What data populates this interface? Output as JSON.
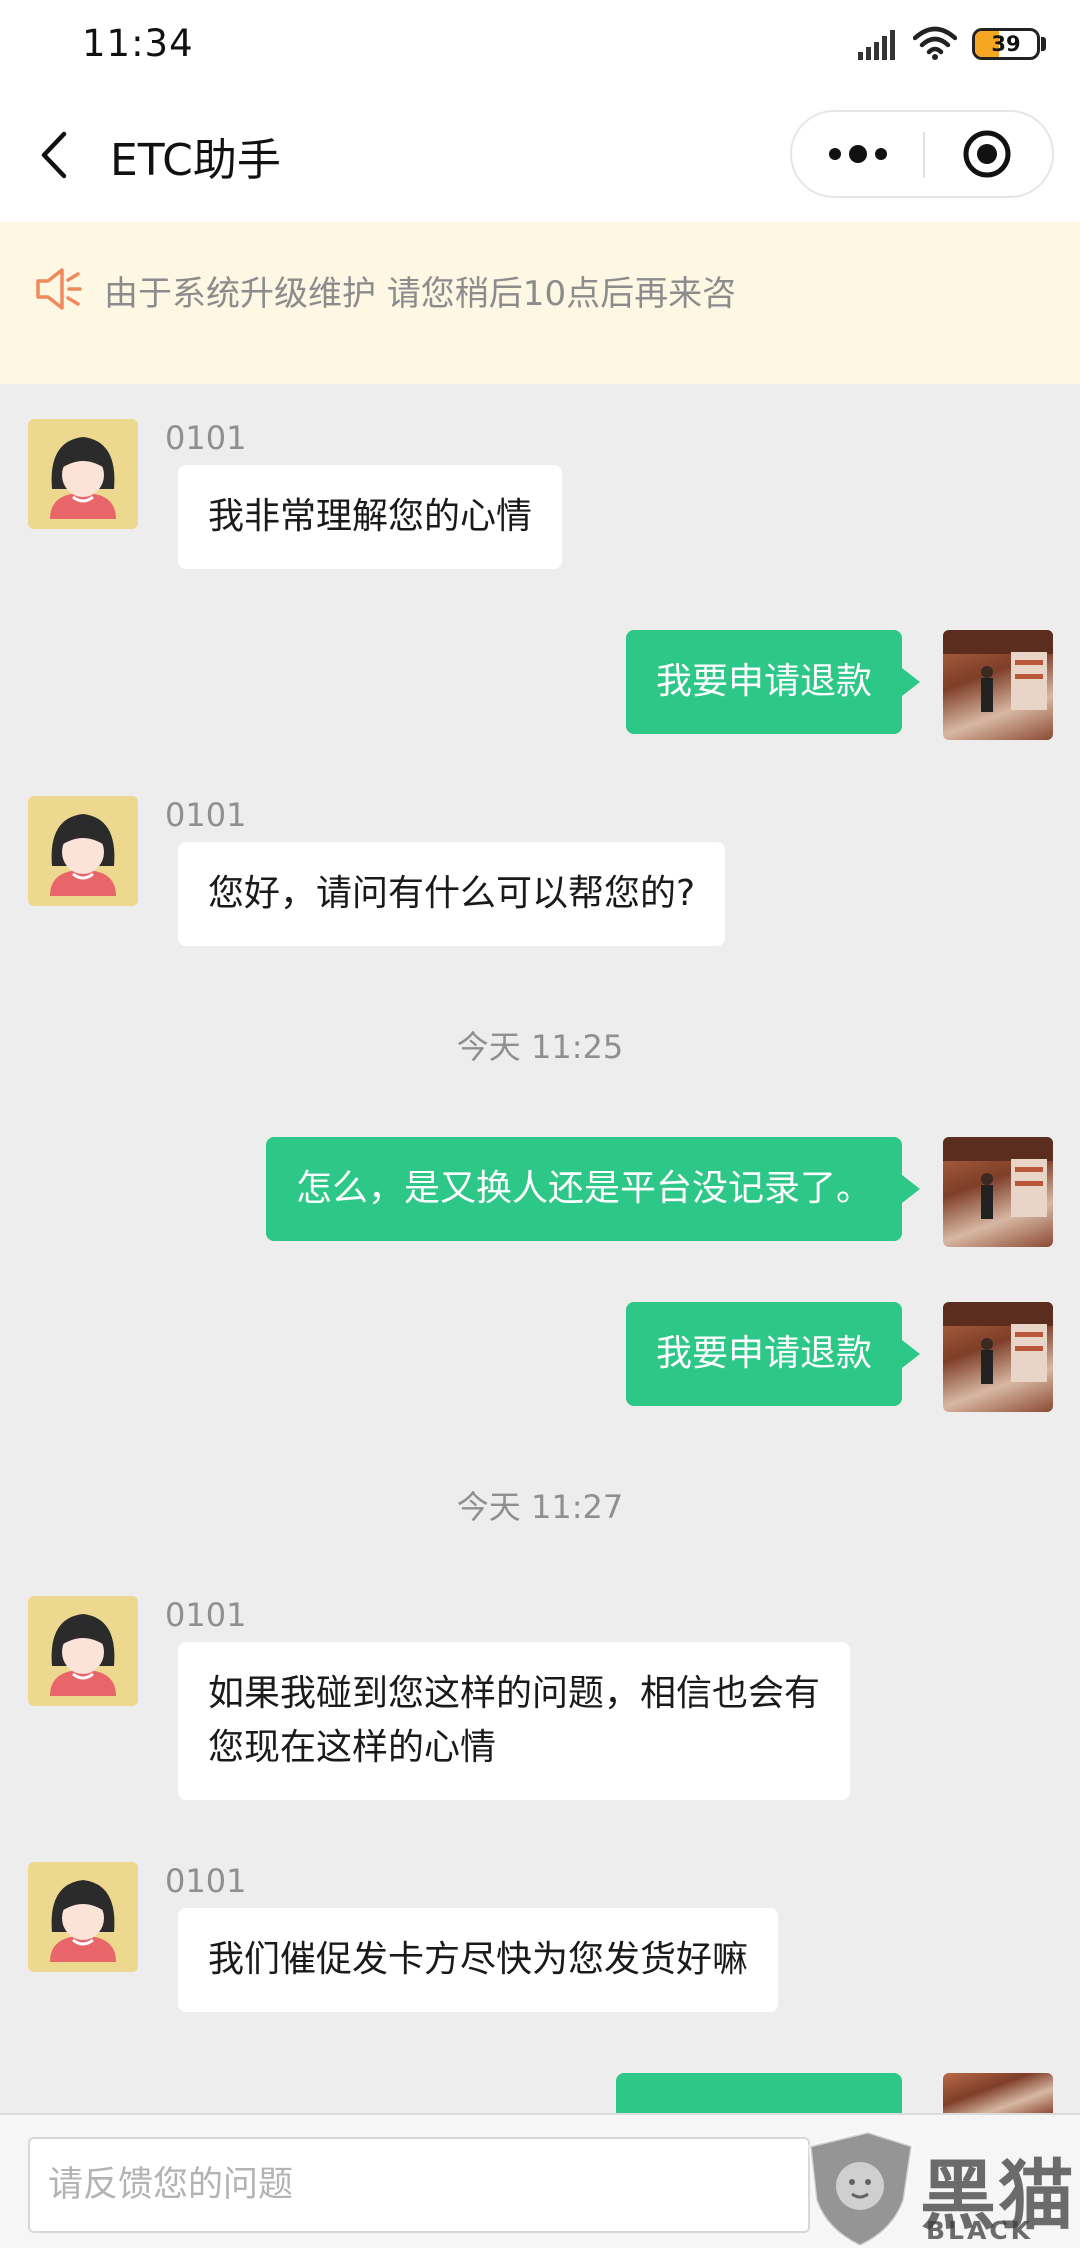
{
  "status_bar": {
    "time": "11:34",
    "battery": "39",
    "battery_level_percent": 39
  },
  "nav": {
    "title": "ETC助手"
  },
  "notice": {
    "text": "由于系统升级维护 请您稍后10点后再来咨"
  },
  "chat": {
    "messages": [
      {
        "side": "left",
        "sender": "0101",
        "text": "我非常理解您的心情"
      },
      {
        "side": "right",
        "text": "我要申请退款"
      },
      {
        "side": "left",
        "sender": "0101",
        "text": "您好，请问有什么可以帮您的?"
      },
      {
        "type": "time",
        "text": "今天 11:25"
      },
      {
        "side": "right",
        "text": "怎么，是又换人还是平台没记录了。"
      },
      {
        "side": "right",
        "text": "我要申请退款"
      },
      {
        "type": "time",
        "text": "今天 11:27"
      },
      {
        "side": "left",
        "sender": "0101",
        "text": "如果我碰到您这样的问题，相信也会有\n您现在这样的心情"
      },
      {
        "side": "left",
        "sender": "0101",
        "text": "我们催促发卡方尽快为您发货好嘛"
      }
    ]
  },
  "input": {
    "placeholder": "请反馈您的问题"
  },
  "watermark": {
    "text": "黑猫",
    "sub": "BLACK CAT"
  },
  "colors": {
    "accent_green": "#2dc787",
    "notice_bg": "#fdf7e4",
    "notice_icon": "#f08a5d"
  }
}
